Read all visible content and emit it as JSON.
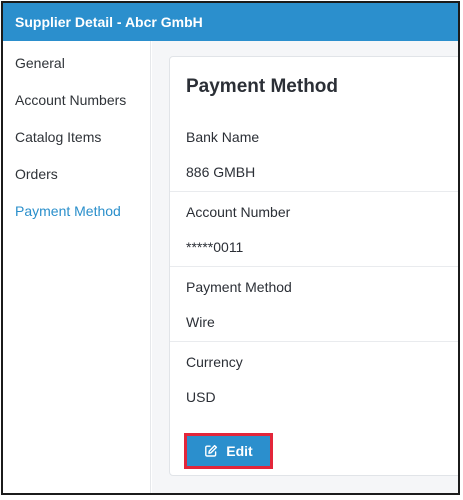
{
  "window": {
    "title": "Supplier Detail - Abcr GmbH"
  },
  "sidebar": {
    "items": [
      {
        "label": "General",
        "active": false
      },
      {
        "label": "Account Numbers",
        "active": false
      },
      {
        "label": "Catalog Items",
        "active": false
      },
      {
        "label": "Orders",
        "active": false
      },
      {
        "label": "Payment Method",
        "active": true
      }
    ]
  },
  "card": {
    "title": "Payment Method",
    "fields": [
      {
        "label": "Bank Name",
        "value": "886 GMBH"
      },
      {
        "label": "Account Number",
        "value": "*****0011"
      },
      {
        "label": "Payment Method",
        "value": "Wire"
      },
      {
        "label": "Currency",
        "value": "USD"
      }
    ],
    "edit_label": "Edit",
    "edit_icon": "edit-pencil-icon"
  },
  "colors": {
    "accent": "#2b8fcd",
    "active_nav": "#2a8fcb",
    "highlight_border": "#e3263a"
  }
}
